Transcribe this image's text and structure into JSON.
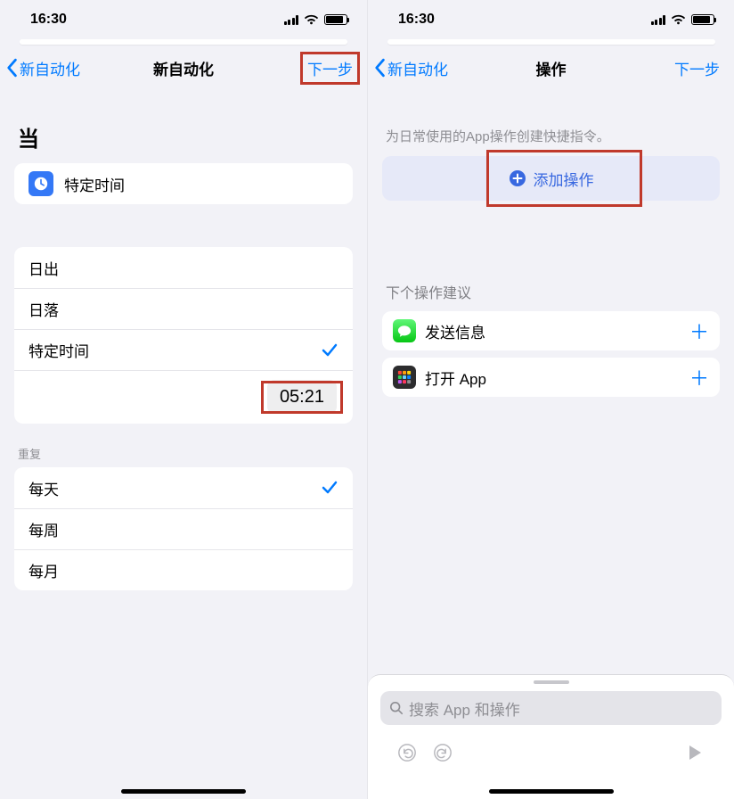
{
  "left": {
    "status": {
      "time": "16:30"
    },
    "nav": {
      "back": "新自动化",
      "title": "新自动化",
      "next": "下一步"
    },
    "when_label": "当",
    "header_cell": {
      "label": "特定时间"
    },
    "time_options": {
      "sunrise": "日出",
      "sunset": "日落",
      "specific": "特定时间",
      "picked_time": "05:21"
    },
    "repeat_label": "重复",
    "repeat": {
      "daily": "每天",
      "weekly": "每周",
      "monthly": "每月"
    }
  },
  "right": {
    "status": {
      "time": "16:30"
    },
    "nav": {
      "back": "新自动化",
      "title": "操作",
      "next": "下一步"
    },
    "desc": "为日常使用的App操作创建快捷指令。",
    "add_action": "添加操作",
    "suggest_label": "下个操作建议",
    "suggestions": {
      "send_msg": "发送信息",
      "open_app": "打开 App"
    },
    "search_placeholder": "搜索 App 和操作"
  }
}
